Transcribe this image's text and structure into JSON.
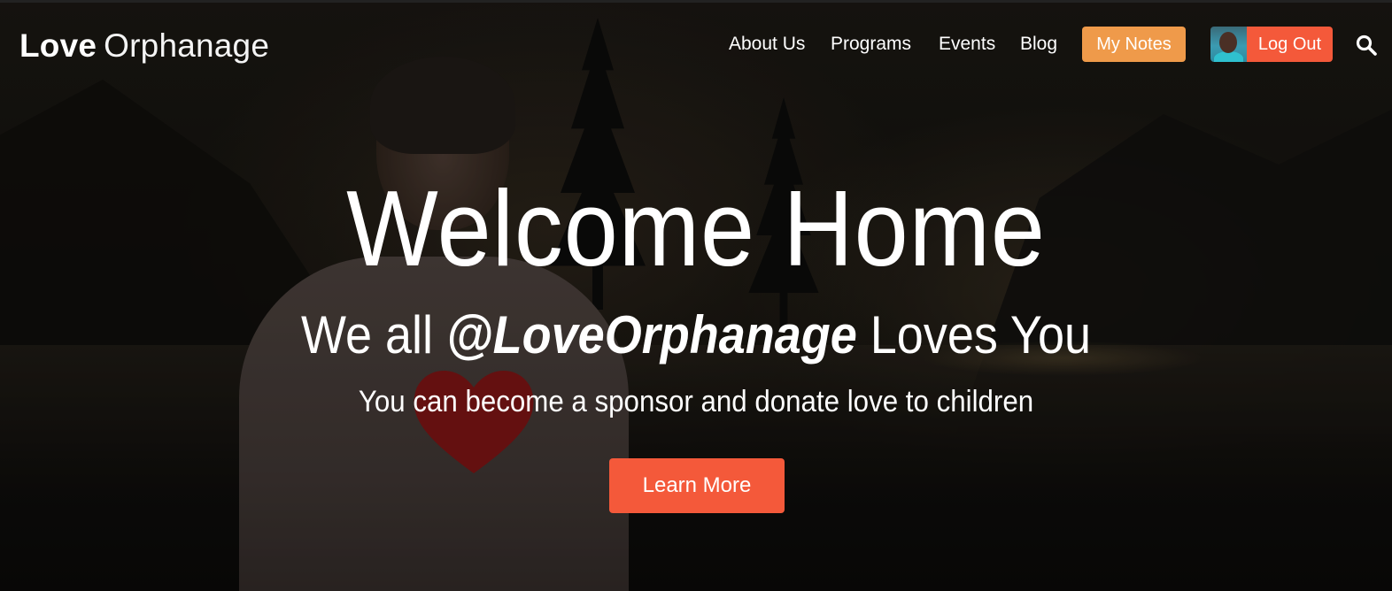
{
  "brand": {
    "strong": "Love",
    "light": "Orphanage"
  },
  "nav": {
    "links": [
      {
        "label": "About Us"
      },
      {
        "label": "Programs"
      },
      {
        "label": "Events"
      },
      {
        "label": "Blog"
      }
    ],
    "my_notes_label": "My Notes",
    "logout_label": "Log Out",
    "search_icon": "search-icon",
    "avatar_icon": "user-avatar"
  },
  "hero": {
    "title": "Welcome Home",
    "subtitle_prefix": "We all",
    "subtitle_handle": "@LoveOrphanage",
    "subtitle_suffix": "Loves You",
    "description": "You can become a sponsor and donate love to children",
    "cta_label": "Learn More"
  },
  "colors": {
    "accent_orange": "#ef9a4a",
    "accent_red": "#f4593a",
    "text": "#ffffff"
  }
}
